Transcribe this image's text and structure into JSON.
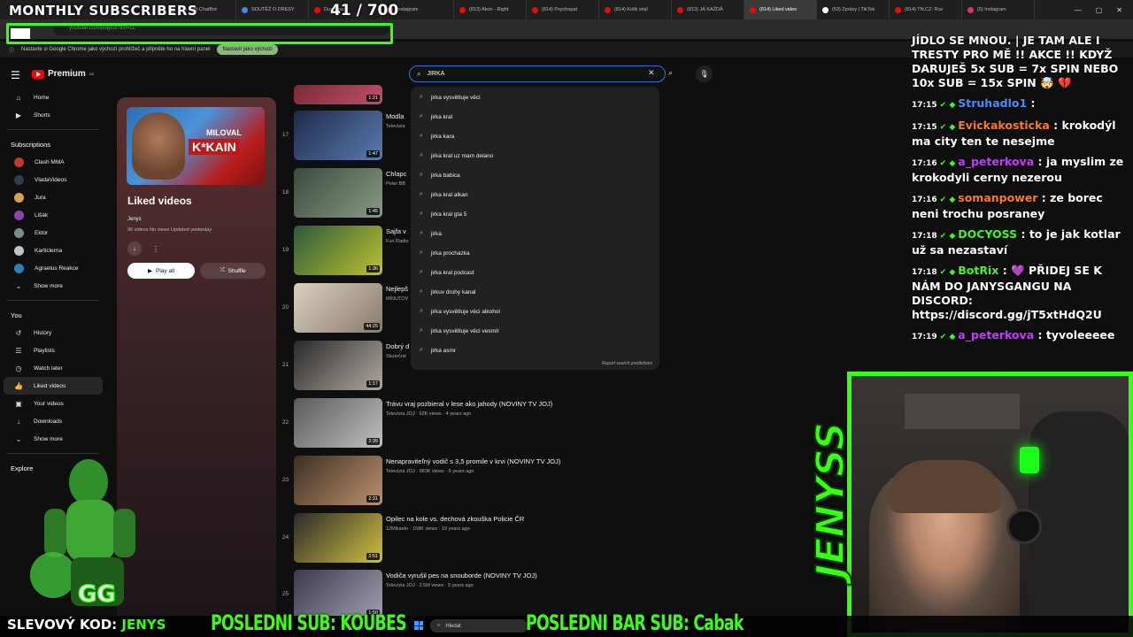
{
  "overlay": {
    "title": "MONTHLY SUBSCRIBERS",
    "count": "41 / 700",
    "promo_label": "SLEVOVÝ KOD:",
    "promo_code": "JENYS",
    "last_sub": "POSLEDNI SUB: KOUBES",
    "last_bar": "POSLEDNI BAR SUB: Cabak",
    "streamer_name": "JENYSS"
  },
  "browser": {
    "tabs": [
      {
        "label": "The best ChatBot",
        "color": "#9b59b6"
      },
      {
        "label": "SOUTĚŽ O DRESY",
        "color": "#4285f4"
      },
      {
        "label": "Dua Lipa",
        "color": "#ff0000"
      },
      {
        "label": "Instagram",
        "color": "#e1306c"
      },
      {
        "label": "(813) Akon - Right",
        "color": "#ff0000"
      },
      {
        "label": "(814) Psychopat",
        "color": "#ff0000"
      },
      {
        "label": "(814) Kolik stojí",
        "color": "#ff0000"
      },
      {
        "label": "(813) JÁ KAŽDÁ",
        "color": "#ff0000"
      },
      {
        "label": "(814) Liked video",
        "color": "#ff0000",
        "active": true
      },
      {
        "label": "(53) Zprávy | TikTok",
        "color": "#ffffff"
      },
      {
        "label": "(814) TN.CZ: Roz",
        "color": "#ff0000"
      },
      {
        "label": "(5) Instagram",
        "color": "#e1306c"
      }
    ],
    "address": "youtube.com/playlist?list=LL",
    "infobar_text": "Nastavte si Google Chrome jako výchozí prohlížeč a připněte ho na hlavní panel",
    "infobar_button": "Nastavit jako výchozí"
  },
  "youtube": {
    "logo": "Premium",
    "logo_sup": "CZ",
    "search": {
      "value": "JIRKA",
      "suggestions": [
        "jirka vysvětluje věci",
        "jirka kral",
        "jirka kara",
        "jirka kral uz mam delano",
        "jirka babica",
        "jirka kral alkan",
        "jirka kral gta 5",
        "jirka",
        "jirka prochazka",
        "jirka kral podcast",
        "jirkuv druhy kanal",
        "jirka vysvětluje věci alkohol",
        "jirka vysvětluje věci vesmír",
        "jirka asmr"
      ],
      "report": "Report search predictions"
    },
    "sidebar": {
      "top": [
        {
          "label": "Home",
          "icon": "home-icon",
          "glyph": "⌂"
        },
        {
          "label": "Shorts",
          "icon": "shorts-icon",
          "glyph": "▶"
        }
      ],
      "subscriptions_header": "Subscriptions",
      "subscriptions": [
        {
          "label": "Clash MMA",
          "color": "#c0392b"
        },
        {
          "label": "VladaVideos",
          "color": "#2c3e50"
        },
        {
          "label": "Jura",
          "color": "#d4a24c"
        },
        {
          "label": "Lišák",
          "color": "#8e44ad"
        },
        {
          "label": "Ektor",
          "color": "#7f8c8d"
        },
        {
          "label": "Karticlerna",
          "color": "#bdc3c7"
        },
        {
          "label": "Agraelus Reakce",
          "color": "#2980b9"
        }
      ],
      "show_more": "Show more",
      "you_header": "You",
      "you_items": [
        {
          "label": "History",
          "icon": "history-icon",
          "glyph": "↺"
        },
        {
          "label": "Playlists",
          "icon": "playlists-icon",
          "glyph": "☰"
        },
        {
          "label": "Watch later",
          "icon": "watch-later-icon",
          "glyph": "◷"
        },
        {
          "label": "Liked videos",
          "icon": "like-icon",
          "glyph": "👍"
        },
        {
          "label": "Your videos",
          "icon": "your-videos-icon",
          "glyph": "▣"
        },
        {
          "label": "Downloads",
          "icon": "downloads-icon",
          "glyph": "↓"
        }
      ],
      "show_more_2": "Show more",
      "explore_header": "Explore"
    },
    "playlist": {
      "thumb_text_1": "MILOVAL",
      "thumb_text_2": "K*KAIN",
      "title": "Liked videos",
      "owner": "Jenys",
      "meta": "96 videos  No views  Updated yesterday",
      "play_all": "Play all",
      "shuffle": "Shuffle"
    },
    "videos": [
      {
        "num": "",
        "title": "",
        "meta": "",
        "duration": "1:21",
        "c1": "#7a2a3a",
        "c2": "#c0506a"
      },
      {
        "num": "17",
        "title": "Modla",
        "meta": "Televízia",
        "duration": "1:47",
        "c1": "#1d2b4a",
        "c2": "#5a7ab0"
      },
      {
        "num": "18",
        "title": "Chlapc",
        "meta": "Peter BB",
        "duration": "1:45",
        "c1": "#3b4a3a",
        "c2": "#8a9a88"
      },
      {
        "num": "19",
        "title": "Sajfa v",
        "meta": "Fun Radio",
        "duration": "1:36",
        "c1": "#2a5a3a",
        "c2": "#c0c030"
      },
      {
        "num": "20",
        "title": "Nejlepš",
        "meta": "MINUTOV",
        "duration": "44:25",
        "c1": "#d8d0c0",
        "c2": "#8a7a6a"
      },
      {
        "num": "21",
        "title": "Dobrý d",
        "meta": "Skutočné",
        "duration": "1:17",
        "c1": "#2a2a2a",
        "c2": "#b0a8a0"
      },
      {
        "num": "22",
        "title": "Trávu vraj pozbieral v lese ako jahody (NOVINY TV JOJ)",
        "meta": "Televízia JOJ · 62K views · 4 years ago",
        "duration": "2:39",
        "c1": "#5a5a5a",
        "c2": "#c0c0c0"
      },
      {
        "num": "23",
        "title": "Nenapraviteľný vodič s 3,5 promile v krvi (NOVINY TV JOJ)",
        "meta": "Televízia JOJ · 983K views · 6 years ago",
        "duration": "2:31",
        "c1": "#3a3020",
        "c2": "#c09070"
      },
      {
        "num": "24",
        "title": "Opilec na kole vs. dechová zkouška Policie ČR",
        "meta": "12Mikaelo · 158K views · 10 years ago",
        "duration": "2:51",
        "c1": "#2a2a2a",
        "c2": "#d0c040"
      },
      {
        "num": "25",
        "title": "Vodiča vyrušil pes na snoubordе (NOVINY TV JOJ)",
        "meta": "Televízia JOJ · 2.5M views · 5 years ago",
        "duration": "1:50",
        "c1": "#3a3a4a",
        "c2": "#a0a0b0"
      }
    ]
  },
  "chat": [
    {
      "time": "",
      "user": "",
      "user_color": "#ffffff",
      "text": "JÍDLO SE MNOU. | JE TAM ALE I TRESTY PRO MĚ !! AKCE !! KDYŽ DARUJEŠ 5x SUB = 7x SPIN NEBO 10x SUB = 15x SPIN 🤯 💔"
    },
    {
      "time": "17:15",
      "user": "Struhadlo1",
      "user_color": "#4a8cff",
      "text": ""
    },
    {
      "time": "17:15",
      "user": "Evickakosticka",
      "user_color": "#ff7a1a",
      "text": "krokodýl ma city ten te nesejme"
    },
    {
      "time": "17:16",
      "user": "a_peterkova",
      "user_color": "#c23bff",
      "text": "ja myslim ze krokodyli cerny nezerou"
    },
    {
      "time": "17:16",
      "user": "somanpower",
      "user_color": "#ff7a1a",
      "text": "ze borec neni trochu posraney"
    },
    {
      "time": "17:18",
      "user": "DOCYOSS",
      "user_color": "#39ff14",
      "text": "to je jak kotlar už sa nezastaví"
    },
    {
      "time": "17:18",
      "user": "BotRix",
      "user_color": "#39ff14",
      "text": "💜 PŘIDEJ SE K NÁM DO JANYSGANGU NA DISCORD: https://discord.gg/jT5xtHdQ2U"
    },
    {
      "time": "17:19",
      "user": "a_peterkova",
      "user_color": "#c23bff",
      "text": "tyvoleeeee"
    }
  ],
  "taskbar": {
    "search_placeholder": "Hledat"
  }
}
